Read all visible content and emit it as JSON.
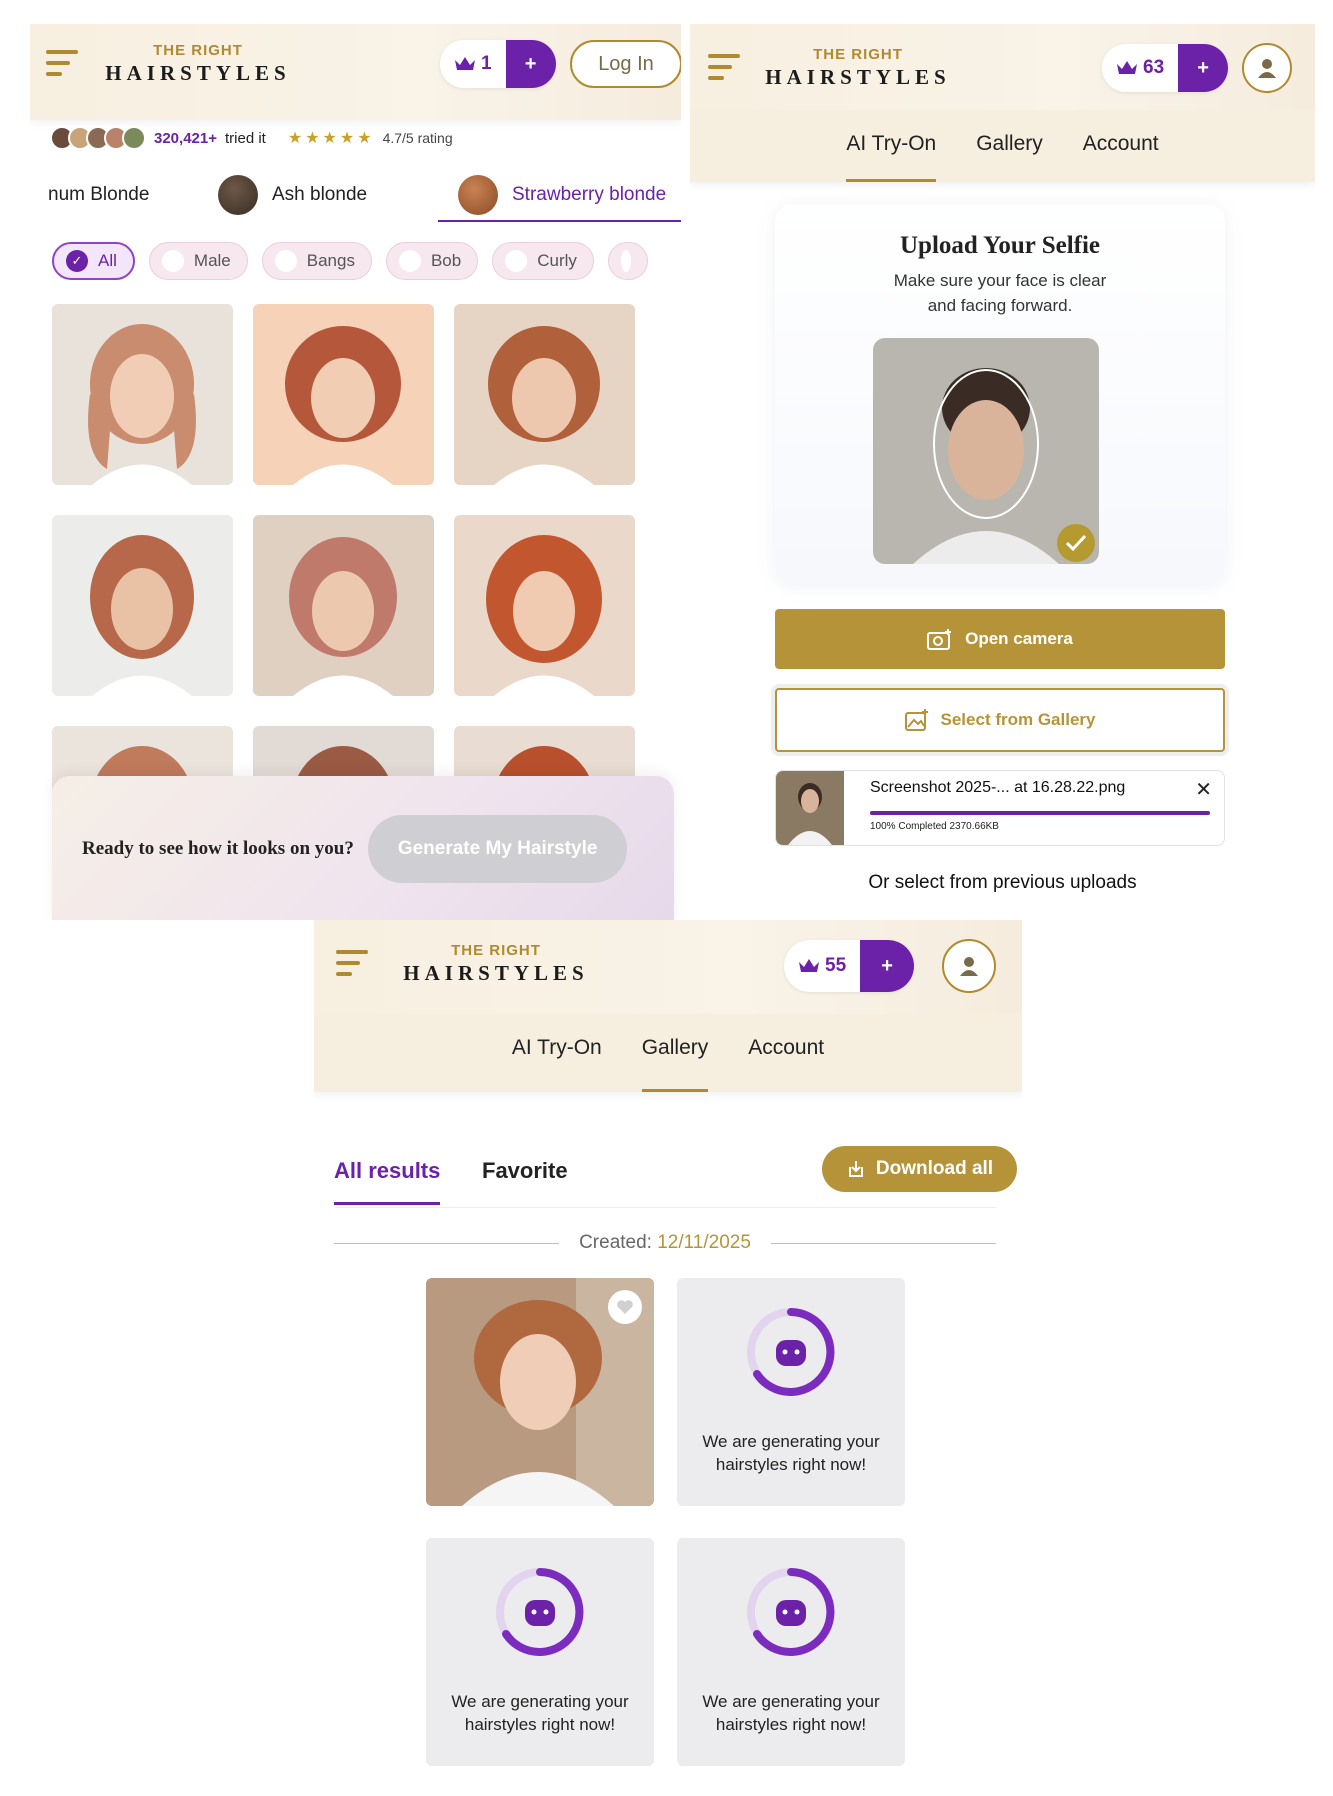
{
  "brand": {
    "top": "THE RIGHT",
    "bottom": "HAIRSTYLES",
    "gold": "#b08a2e",
    "purple": "#6b21a8"
  },
  "panel1": {
    "credits": "1",
    "plus": "+",
    "login": "Log In",
    "social": {
      "count": "320,421+",
      "tried": "tried it",
      "stars": "★★★★★",
      "rating": "4.7/5 rating"
    },
    "color_tabs": [
      {
        "label": "num Blonde"
      },
      {
        "label": "Ash blonde",
        "swatch": "#4a3b30"
      },
      {
        "label": "Strawberry blonde",
        "swatch": "#a9633a",
        "active": true
      }
    ],
    "chips": [
      {
        "label": "All",
        "active": true
      },
      {
        "label": "Male"
      },
      {
        "label": "Bangs"
      },
      {
        "label": "Bob"
      },
      {
        "label": "Curly"
      }
    ],
    "cta": {
      "question": "Ready to see how it looks on you?",
      "button": "Generate My Hairstyle"
    }
  },
  "panel2": {
    "credits": "63",
    "plus": "+",
    "nav": [
      "AI Try-On",
      "Gallery",
      "Account"
    ],
    "nav_active": "AI Try-On",
    "upload": {
      "title": "Upload Your Selfie",
      "line1": "Make sure your face is clear",
      "line2": "and facing forward."
    },
    "open_camera": "Open camera",
    "select_gallery": "Select from Gallery",
    "file": {
      "name": "Screenshot 2025-... at 16.28.22.png",
      "progress": "100% Completed 2370.66KB",
      "progress_value": 1.0
    },
    "previous": "Or select from previous uploads"
  },
  "panel3": {
    "credits": "55",
    "plus": "+",
    "nav": [
      "AI Try-On",
      "Gallery",
      "Account"
    ],
    "nav_active": "Gallery",
    "tabs": {
      "all": "All results",
      "favorite": "Favorite"
    },
    "download": "Download all",
    "created_label": "Created:",
    "created_date": "12/11/2025",
    "generating_line1": "We are generating your",
    "generating_line2": "hairstyles right now!"
  }
}
